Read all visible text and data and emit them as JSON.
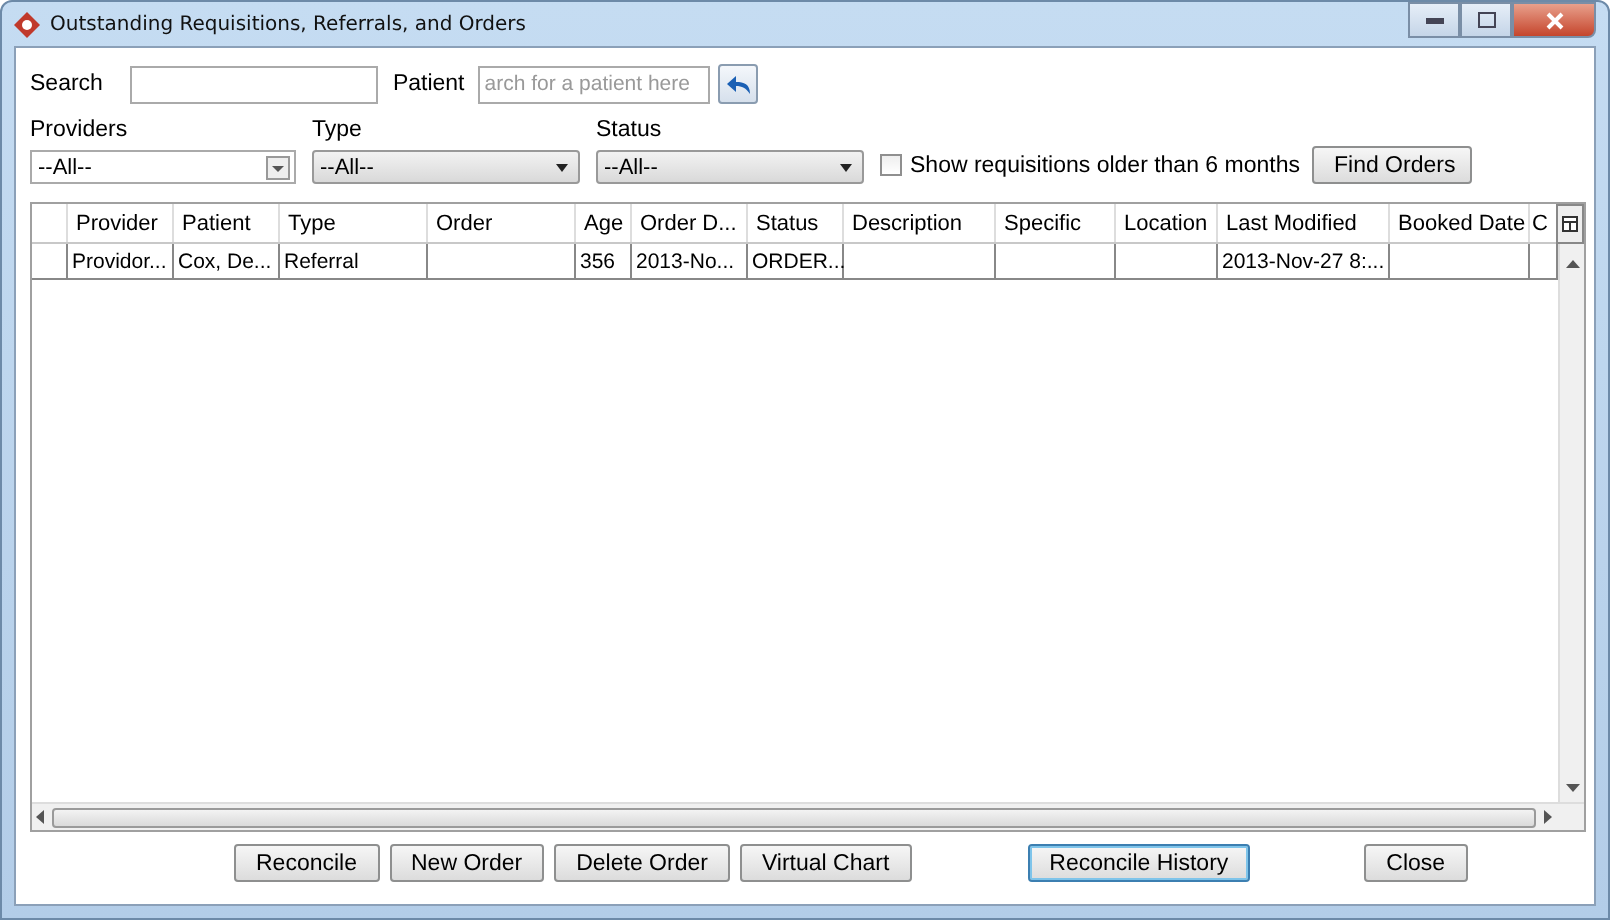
{
  "window": {
    "title": "Outstanding Requisitions, Referrals, and Orders"
  },
  "search": {
    "label": "Search"
  },
  "patient": {
    "label": "Patient",
    "placeholder": "arch for a patient here"
  },
  "filters": [
    {
      "label": "Providers",
      "value": "--All--",
      "kind": "combo"
    },
    {
      "label": "Type",
      "value": "--All--",
      "kind": "select"
    },
    {
      "label": "Status",
      "value": "--All--",
      "kind": "select"
    }
  ],
  "older_checkbox": {
    "label": "Show requisitions older than 6 months",
    "checked": false
  },
  "find_button": "Find Orders",
  "table": {
    "columns": [
      "Provider",
      "Patient",
      "Type",
      "Order",
      "Age",
      "Order D...",
      "Status",
      "Description",
      "Specific",
      "Location",
      "Last Modified",
      "Booked Date",
      "C"
    ],
    "rows": [
      [
        "Providor...",
        "Cox, De...",
        "Referral",
        "",
        "356",
        "2013-No...",
        "ORDER...",
        "",
        "",
        "",
        "2013-Nov-27 8:...",
        "",
        ""
      ]
    ]
  },
  "buttons": [
    {
      "label": "Reconcile",
      "default": false
    },
    {
      "label": "New Order",
      "default": false
    },
    {
      "label": "Delete Order",
      "default": false
    },
    {
      "label": "Virtual Chart",
      "default": false
    },
    {
      "label": "Reconcile History",
      "default": true
    },
    {
      "label": "Close",
      "default": false
    }
  ]
}
